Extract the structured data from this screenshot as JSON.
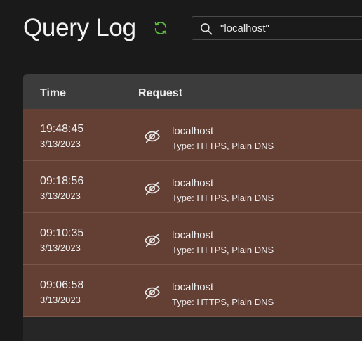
{
  "header": {
    "title": "Query Log",
    "refresh_icon": "refresh-icon",
    "accent_color": "#5bbf3c"
  },
  "search": {
    "icon": "search-icon",
    "value": "\"localhost\""
  },
  "table": {
    "columns": [
      "Time",
      "Request"
    ],
    "row_color": "#643f34",
    "rows": [
      {
        "time": "19:48:45",
        "date": "3/13/2023",
        "icon": "eye-slash-icon",
        "domain": "localhost",
        "type": "Type: HTTPS, Plain DNS"
      },
      {
        "time": "09:18:56",
        "date": "3/13/2023",
        "icon": "eye-slash-icon",
        "domain": "localhost",
        "type": "Type: HTTPS, Plain DNS"
      },
      {
        "time": "09:10:35",
        "date": "3/13/2023",
        "icon": "eye-slash-icon",
        "domain": "localhost",
        "type": "Type: HTTPS, Plain DNS"
      },
      {
        "time": "09:06:58",
        "date": "3/13/2023",
        "icon": "eye-slash-icon",
        "domain": "localhost",
        "type": "Type: HTTPS, Plain DNS"
      }
    ]
  }
}
